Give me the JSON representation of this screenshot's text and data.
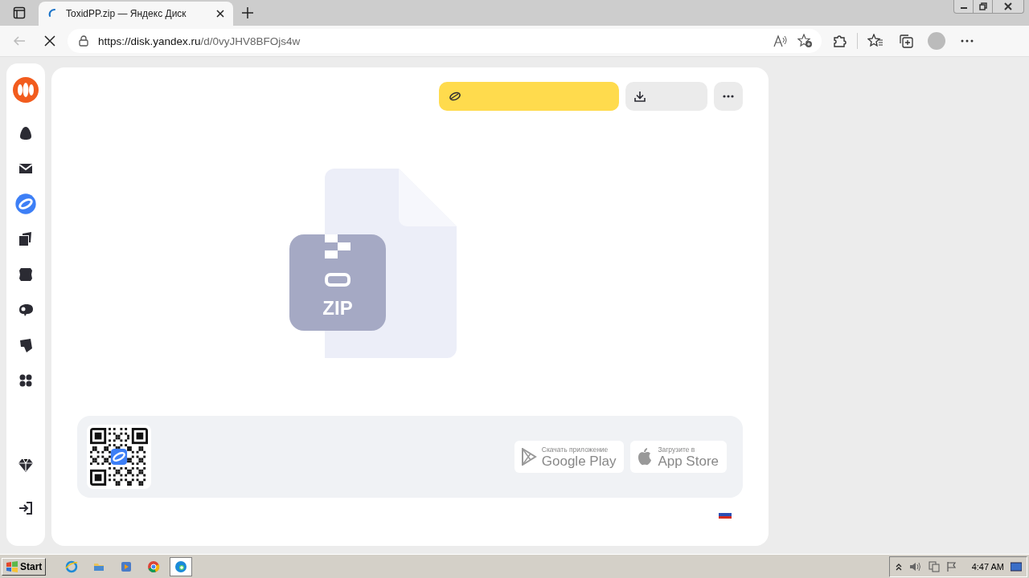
{
  "browser": {
    "tab_title": "ToxidPP.zip — Яндекс Диск",
    "url_host": "https://disk.yandex.ru",
    "url_path": "/d/0vyJHV8BFOjs4w"
  },
  "sidebar": {
    "items": [
      {
        "kind": "mail-service",
        "selected": false
      },
      {
        "kind": "mail",
        "selected": false
      },
      {
        "kind": "disk",
        "selected": true
      },
      {
        "kind": "photos",
        "selected": false
      },
      {
        "kind": "docs",
        "selected": false
      },
      {
        "kind": "messenger",
        "selected": false
      },
      {
        "kind": "notes",
        "selected": false
      },
      {
        "kind": "apps",
        "selected": false
      }
    ],
    "bottom": [
      {
        "kind": "premium"
      },
      {
        "kind": "login"
      }
    ]
  },
  "file": {
    "type_label": "ZIP"
  },
  "stores": [
    {
      "kind": "google",
      "caption": "Скачать приложение",
      "name": "Google Play"
    },
    {
      "kind": "apple",
      "caption": "Загрузите в",
      "name": "App Store"
    }
  ],
  "taskbar": {
    "start": "Start",
    "apps": [
      {
        "kind": "ie",
        "selected": false
      },
      {
        "kind": "folder",
        "selected": false
      },
      {
        "kind": "media",
        "selected": false
      },
      {
        "kind": "chrome",
        "selected": false
      },
      {
        "kind": "edge",
        "selected": true
      }
    ],
    "clock": "4:47 AM"
  }
}
